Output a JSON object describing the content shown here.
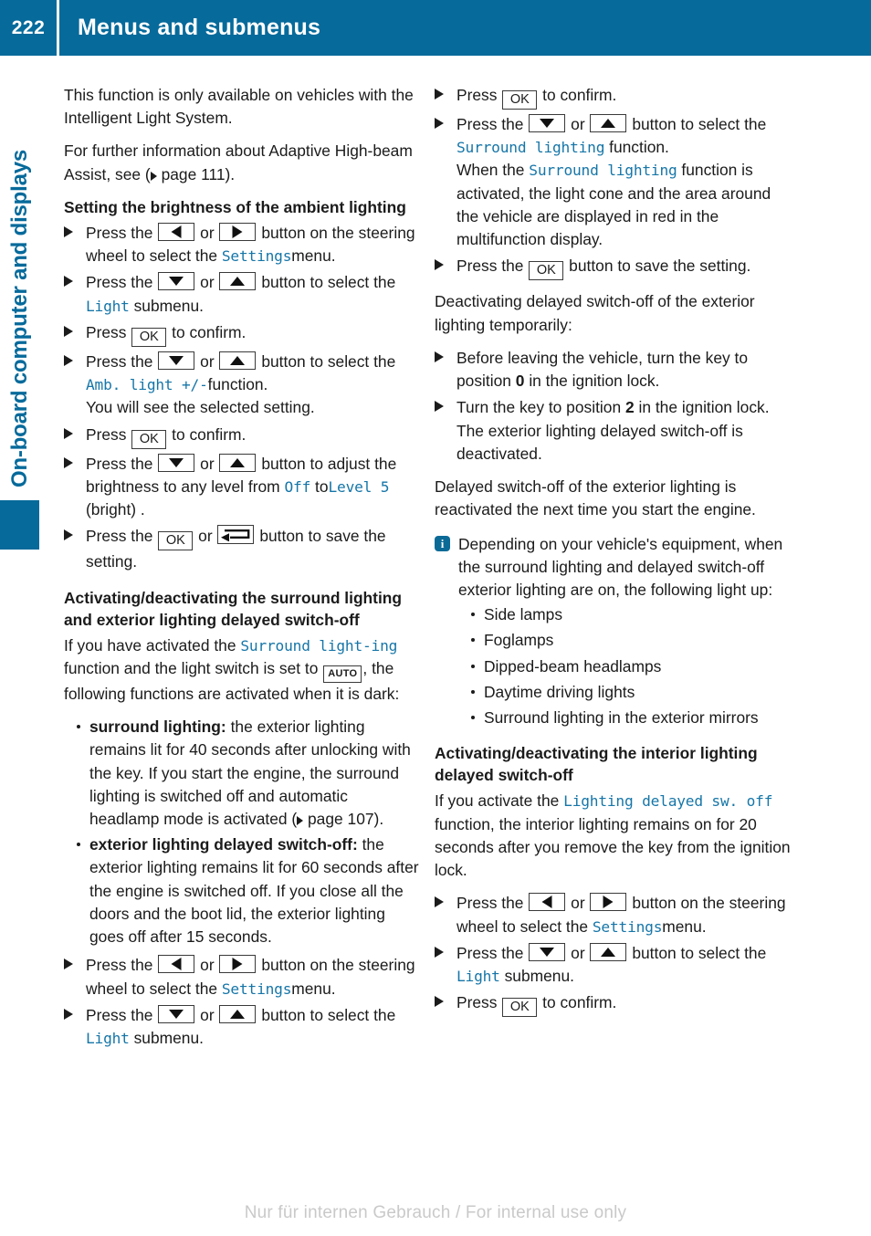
{
  "header": {
    "page_number": "222",
    "title": "Menus and submenus",
    "bg_color": "#066a9b"
  },
  "chapter_tab": {
    "label": "On-board computer and displays",
    "color": "#066a9b"
  },
  "accent_color": "#1676a8",
  "icons": {
    "ok": "OK",
    "auto": "AUTO",
    "back": "back-arrow-icon",
    "left": "left-arrow-icon",
    "right": "right-arrow-icon",
    "up": "up-arrow-icon",
    "down": "down-arrow-icon",
    "info": "i"
  },
  "left_column": {
    "intro_1": "This function is only available on vehicles with the Intelligent Light System.",
    "intro_2_a": "For further information about Adaptive High-beam Assist, see (",
    "intro_2_b": "page 111).",
    "page_ref_1": "page 111",
    "heading_1": "Setting the brightness of the ambient lighting",
    "step1_a": "Press the",
    "step1_b": "or",
    "step1_c": "button on the steering wheel to select the",
    "step1_menu": "Settings",
    "step1_d": "menu.",
    "step2_a": "Press the",
    "step2_b": "or",
    "step2_c": "button to select the",
    "step2_menu": "Light",
    "step2_d": "submenu.",
    "step3_a": "Press",
    "step3_b": "to confirm.",
    "step4_a": "Press the",
    "step4_b": "or",
    "step4_c": "button to select the",
    "step4_menu": "Amb. light +/-",
    "step4_d": "function.",
    "step4_e": "You will see the selected setting.",
    "step5_a": "Press",
    "step5_b": "to confirm.",
    "step6_a": "Press the",
    "step6_b": "or",
    "step6_c": "button to adjust the brightness to any level from",
    "step6_off": "Off",
    "step6_to": "to",
    "step6_level": "Level 5",
    "step6_d": "(bright) .",
    "step7_a": "Press the",
    "step7_b": "or",
    "step7_c": "button to save the setting.",
    "heading_2": "Activating/deactivating the surround lighting and exterior lighting delayed switch-off",
    "para_2_a": "If you have activated the",
    "para_2_fn": "Surround light-ing",
    "para_2_b": "function and the light switch is set to",
    "para_2_c": ", the following functions are activated when it is dark:",
    "bullet_1_label": "surround lighting:",
    "bullet_1_text_a": "the exterior lighting remains lit for 40 seconds after unlocking with the key. If you start the engine, the surround lighting is switched off and automatic headlamp mode is activated (",
    "bullet_1_ref": "page 107",
    "bullet_1_text_b": "page 107).",
    "bullet_2_label": "exterior lighting delayed switch-off:",
    "bullet_2_text": "the exterior lighting remains lit for 60 seconds after the engine is switched off. If you close all the doors and the boot lid, the exterior lighting goes off after 15 seconds.",
    "step8_a": "Press the",
    "step8_b": "or",
    "step8_c": "button on the steering wheel to select the",
    "step8_menu": "Settings",
    "step8_d": "menu.",
    "step9_a": "Press the",
    "step9_b": "or",
    "step9_c": "button to select the",
    "step9_menu": "Light",
    "step9_d": "submenu."
  },
  "right_column": {
    "step1_a": "Press",
    "step1_b": "to confirm.",
    "step2_a": "Press the",
    "step2_b": "or",
    "step2_c": "button to select the",
    "step2_menu": "Surround lighting",
    "step2_d": "function.",
    "step2_e1": "When the",
    "step2_menu2": "Surround lighting",
    "step2_e2": "function is activated, the light cone and the area around the vehicle are displayed in red in the multifunction display.",
    "step3_a": "Press the",
    "step3_b": "button to save the setting.",
    "para_1": "Deactivating delayed switch-off of the exterior lighting temporarily:",
    "step4_a": "Before leaving the vehicle, turn the key to position",
    "step4_pos": "0",
    "step4_b": "in the ignition lock.",
    "step5_a": "Turn the key to position",
    "step5_pos": "2",
    "step5_b": "in the ignition lock.",
    "step5_c": "The exterior lighting delayed switch-off is deactivated.",
    "para_2": "Delayed switch-off of the exterior lighting is reactivated the next time you start the engine.",
    "note_text": "Depending on your vehicle's equipment, when the surround lighting and delayed switch-off exterior lighting are on, the following light up:",
    "note_bullets": [
      "Side lamps",
      "Foglamps",
      "Dipped-beam headlamps",
      "Daytime driving lights",
      "Surround lighting in the exterior mirrors"
    ],
    "heading_1": "Activating/deactivating the interior lighting delayed switch-off",
    "para_3_a": "If you activate the",
    "para_3_fn": "Lighting delayed sw. off",
    "para_3_b": "function, the interior lighting remains on for 20 seconds after you remove the key from the ignition lock.",
    "step6_a": "Press the",
    "step6_b": "or",
    "step6_c": "button on the steering wheel to select the",
    "step6_menu": "Settings",
    "step6_d": "menu.",
    "step7_a": "Press the",
    "step7_b": "or",
    "step7_c": "button to select the",
    "step7_menu": "Light",
    "step7_d": "submenu.",
    "step8_a": "Press",
    "step8_b": "to confirm."
  },
  "footer": {
    "watermark": "Nur für internen Gebrauch / For internal use only"
  }
}
